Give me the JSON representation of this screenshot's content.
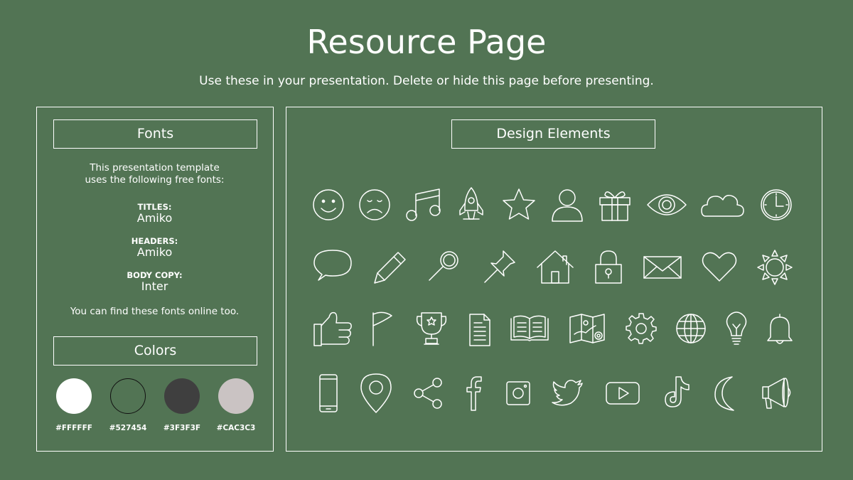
{
  "header": {
    "title": "Resource Page",
    "subtitle": "Use these in your presentation. Delete or hide this page before presenting."
  },
  "fonts": {
    "heading": "Fonts",
    "intro_line1": "This presentation template",
    "intro_line2": "uses the following free fonts:",
    "entries": [
      {
        "label": "TITLES:",
        "font": "Amiko"
      },
      {
        "label": "HEADERS:",
        "font": "Amiko"
      },
      {
        "label": "BODY COPY:",
        "font": "Inter"
      }
    ],
    "footer": "You can find these fonts online too."
  },
  "colors": {
    "heading": "Colors",
    "swatches": [
      {
        "hex": "#FFFFFF"
      },
      {
        "hex": "#527454"
      },
      {
        "hex": "#3F3F3F"
      },
      {
        "hex": "#CAC3C3"
      }
    ]
  },
  "design": {
    "heading": "Design Elements",
    "icons": [
      [
        "smiley-face-icon",
        "sad-face-icon",
        "music-note-icon",
        "rocket-icon",
        "star-icon",
        "user-icon",
        "gift-icon",
        "eye-icon",
        "cloud-icon",
        "clock-icon"
      ],
      [
        "speech-bubble-icon",
        "pencil-icon",
        "magnifier-icon",
        "push-pin-icon",
        "house-icon",
        "padlock-icon",
        "envelope-icon",
        "heart-icon",
        "sun-icon"
      ],
      [
        "thumbs-up-icon",
        "flag-icon",
        "trophy-icon",
        "document-icon",
        "open-book-icon",
        "map-icon",
        "gear-icon",
        "globe-icon",
        "light-bulb-icon",
        "bell-icon"
      ],
      [
        "smartphone-icon",
        "location-pin-icon",
        "share-icon",
        "facebook-icon",
        "instagram-icon",
        "twitter-icon",
        "youtube-icon",
        "tiktok-icon",
        "crescent-moon-icon",
        "megaphone-icon"
      ]
    ]
  }
}
